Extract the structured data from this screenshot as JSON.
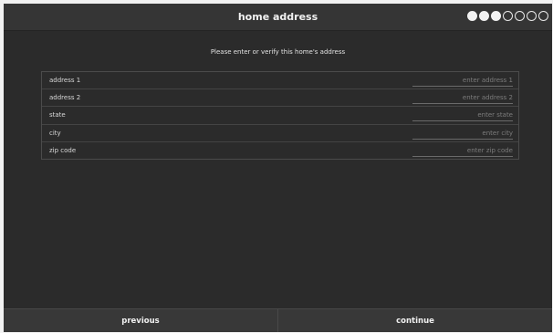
{
  "header": {
    "title": "home address",
    "progress": {
      "total_steps": 7,
      "completed_steps": 3
    }
  },
  "instruction": "Please enter or verify this home's address",
  "form": {
    "fields": [
      {
        "label": "address 1",
        "placeholder": "enter address 1",
        "value": ""
      },
      {
        "label": "address 2",
        "placeholder": "enter address 2",
        "value": ""
      },
      {
        "label": "state",
        "placeholder": "enter state",
        "value": ""
      },
      {
        "label": "city",
        "placeholder": "enter city",
        "value": ""
      },
      {
        "label": "zip code",
        "placeholder": "enter zip code",
        "value": ""
      }
    ]
  },
  "footer": {
    "previous_label": "previous",
    "continue_label": "continue"
  },
  "colors": {
    "background": "#2b2b2b",
    "header": "#353535",
    "footer": "#383838",
    "text": "#f2f2f2"
  }
}
